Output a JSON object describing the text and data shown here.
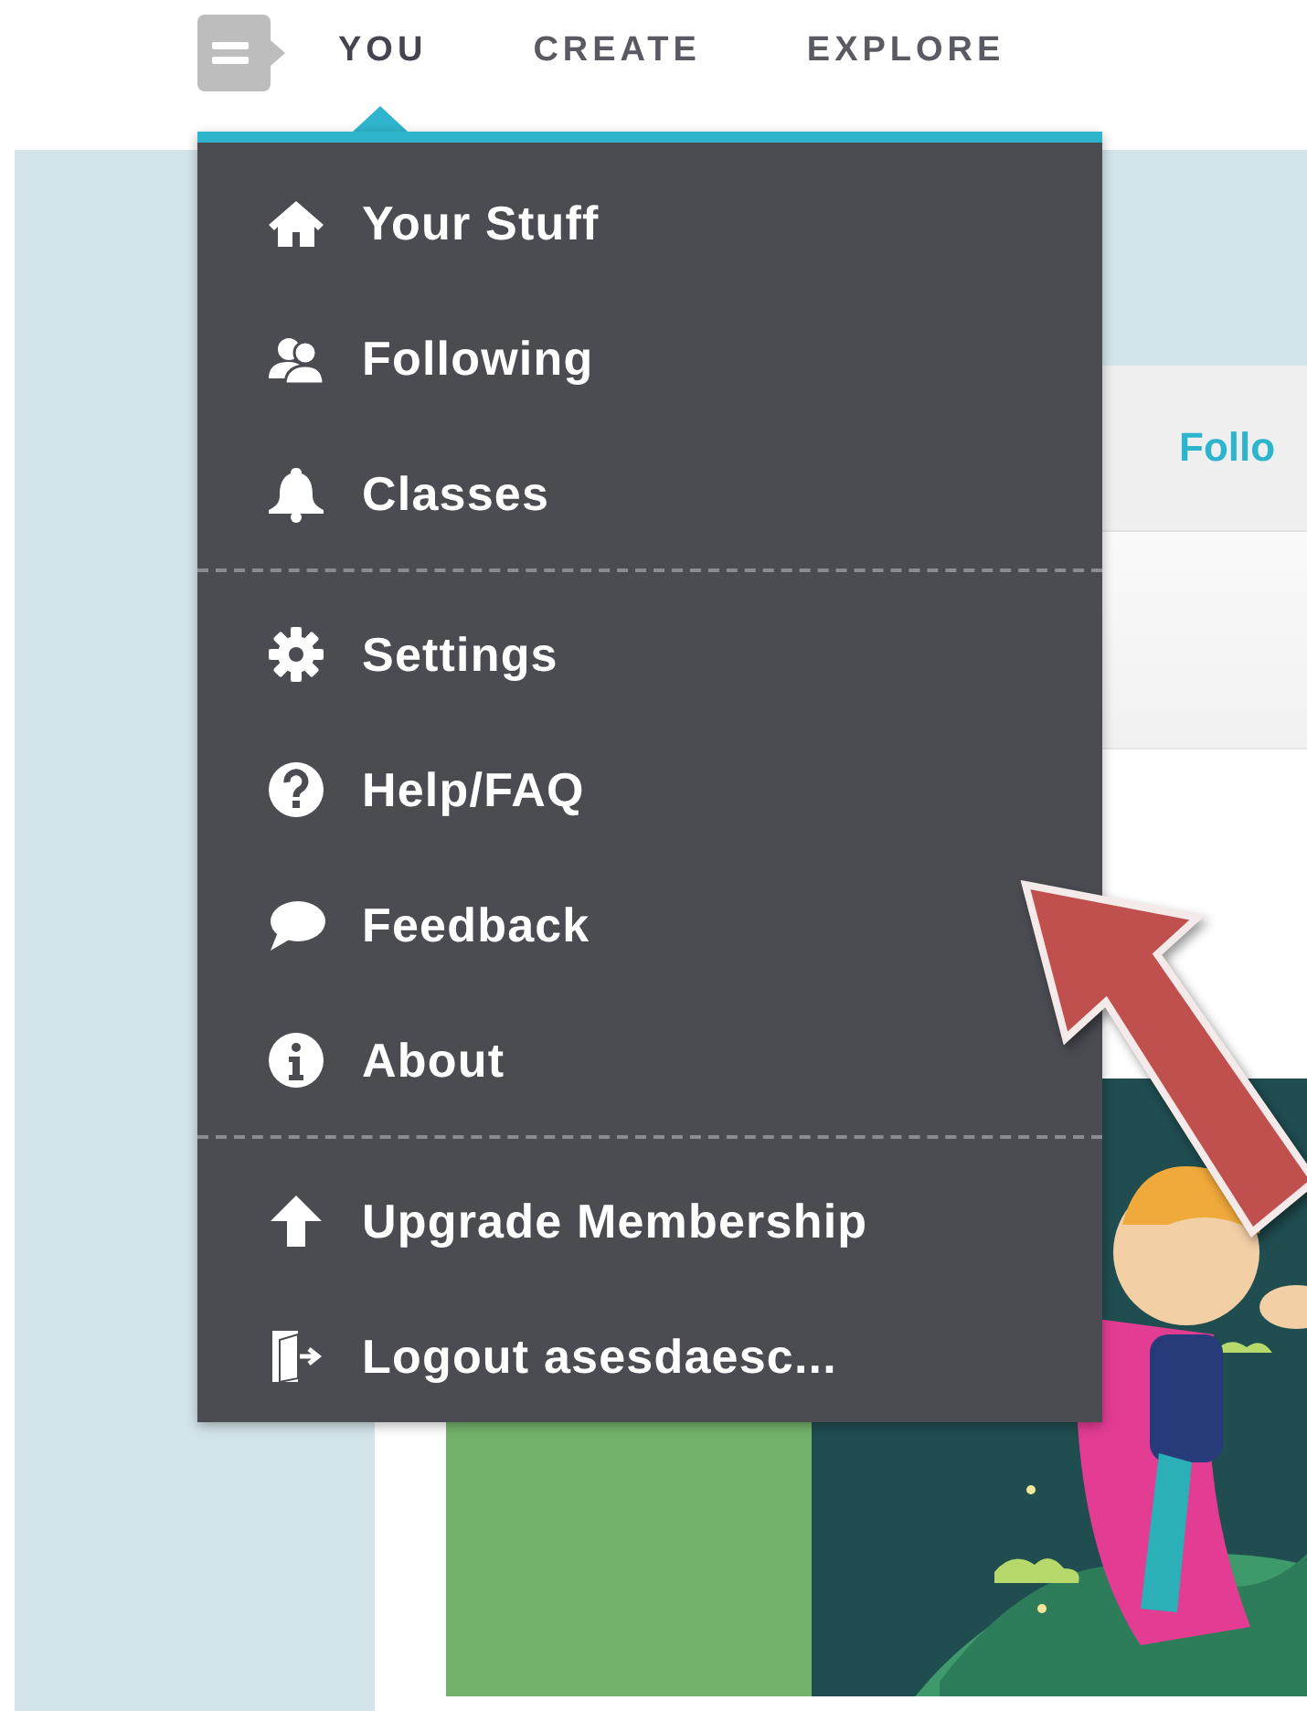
{
  "nav": {
    "tabs": [
      {
        "label": "YOU",
        "selected": true
      },
      {
        "label": "CREATE",
        "selected": false
      },
      {
        "label": "EXPLORE",
        "selected": false
      }
    ]
  },
  "menu": {
    "sections": [
      [
        {
          "label": "Your Stuff"
        },
        {
          "label": "Following"
        },
        {
          "label": "Classes"
        }
      ],
      [
        {
          "label": "Settings"
        },
        {
          "label": "Help/FAQ"
        },
        {
          "label": "Feedback"
        },
        {
          "label": "About"
        }
      ],
      [
        {
          "label": "Upgrade Membership"
        },
        {
          "label": "Logout asesdaesc..."
        }
      ]
    ]
  },
  "panel": {
    "tab_label": "Follo"
  }
}
